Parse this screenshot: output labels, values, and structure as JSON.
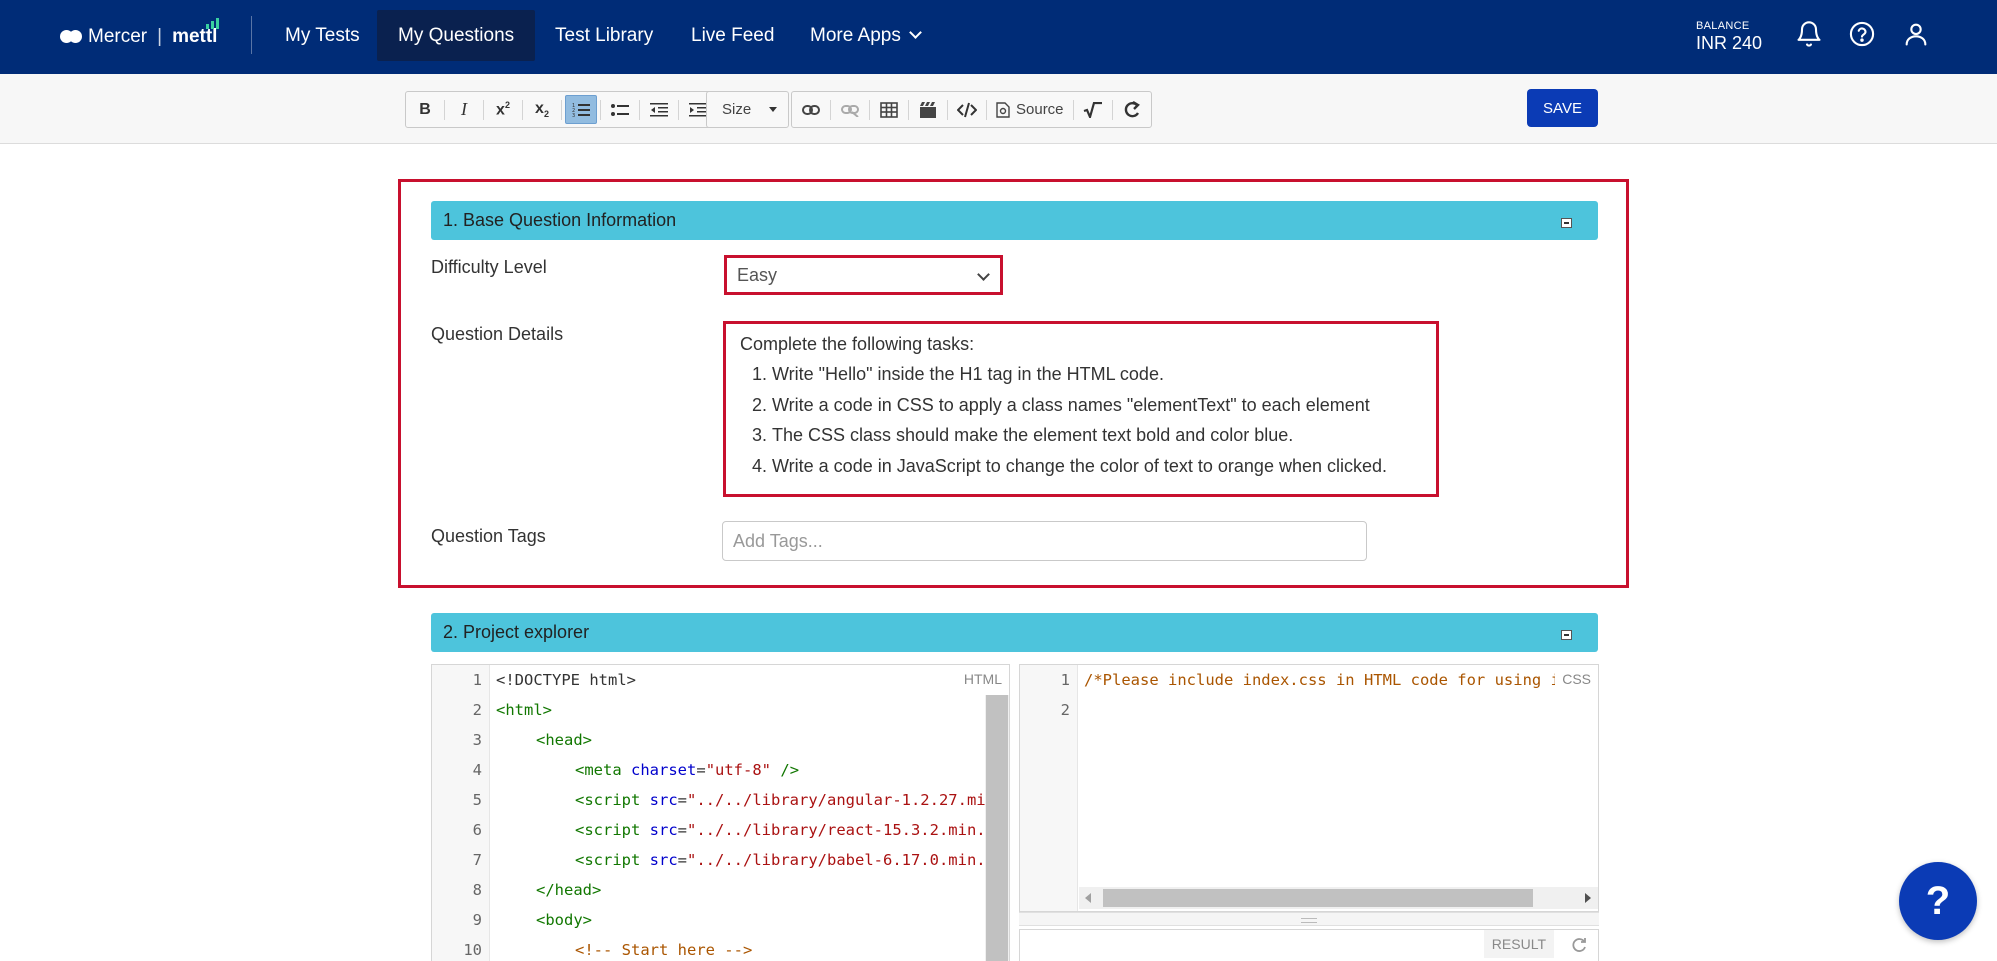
{
  "header": {
    "logo_brand": "Mercer",
    "logo_separator": "|",
    "logo_product": "mettl",
    "nav": [
      {
        "label": "My Tests",
        "active": false
      },
      {
        "label": "My Questions",
        "active": true
      },
      {
        "label": "Test Library",
        "active": false
      },
      {
        "label": "Live Feed",
        "active": false
      },
      {
        "label": "More Apps",
        "active": false,
        "dropdown": true
      }
    ],
    "balance_label": "BALANCE",
    "balance_value": "INR 240",
    "icons": [
      "bell-icon",
      "help-circle-icon",
      "user-icon"
    ],
    "background_color": "#002c77"
  },
  "toolbar": {
    "buttons": [
      "bold-icon",
      "italic-icon",
      "superscript-icon",
      "subscript-icon",
      "numbered-list-icon",
      "bulleted-list-icon",
      "decrease-indent-icon",
      "increase-indent-icon",
      "size-dropdown",
      "link-icon",
      "unlink-icon",
      "table-icon",
      "video-icon",
      "code-icon",
      "source-icon",
      "math-sqrt-icon",
      "refresh-icon"
    ],
    "active_button": "numbered-list-icon",
    "size_label": "Size",
    "source_label": "Source",
    "save_label": "SAVE"
  },
  "section1": {
    "title": "1. Base Question Information",
    "difficulty_label": "Difficulty Level",
    "difficulty_value": "Easy",
    "details_label": "Question Details",
    "details_intro": "Complete the following tasks:",
    "details_items": [
      "Write \"Hello\" inside the H1 tag in the HTML code.",
      "Write a code in CSS to apply a class names \"elementText\" to each element",
      "The CSS class should make the element text bold and color blue.",
      "Write a code in JavaScript to change the color of text to orange when clicked."
    ],
    "tags_label": "Question Tags",
    "tags_placeholder": "Add Tags..."
  },
  "section2": {
    "title": "2. Project explorer",
    "html_editor": {
      "label": "HTML",
      "line_numbers": [
        "1",
        "2",
        "3",
        "4",
        "5",
        "6",
        "7",
        "8",
        "9",
        "10"
      ]
    },
    "css_editor": {
      "label": "CSS",
      "line_numbers": [
        "1",
        "2"
      ],
      "line1": "/*Please include index.css in HTML code for using it*/"
    },
    "result_label": "RESULT"
  },
  "colors": {
    "section_header": "#4dc4dc",
    "highlight_outline": "#c8102e",
    "primary_button": "#0b3bb5"
  },
  "help_fab_label": "?"
}
